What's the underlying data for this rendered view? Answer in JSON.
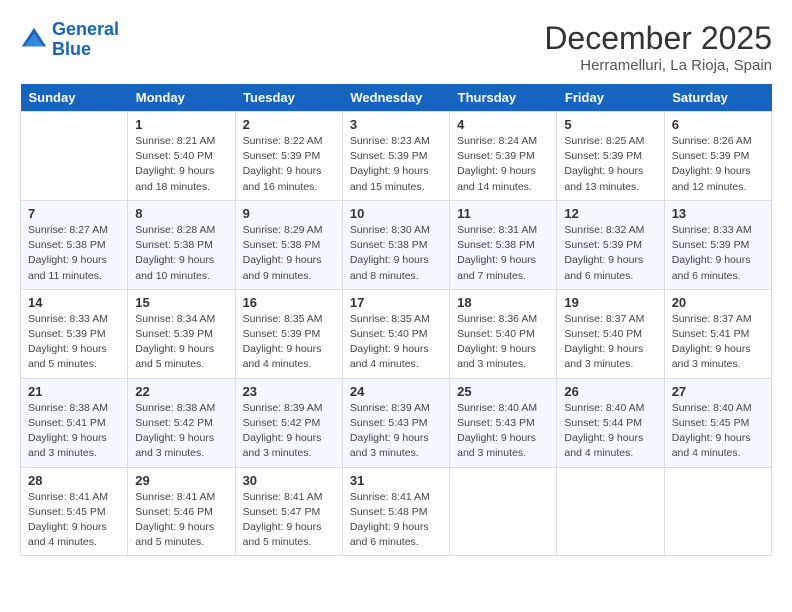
{
  "header": {
    "logo_line1": "General",
    "logo_line2": "Blue",
    "month": "December 2025",
    "location": "Herramelluri, La Rioja, Spain"
  },
  "days_of_week": [
    "Sunday",
    "Monday",
    "Tuesday",
    "Wednesday",
    "Thursday",
    "Friday",
    "Saturday"
  ],
  "weeks": [
    [
      {
        "day": "",
        "info": ""
      },
      {
        "day": "1",
        "info": "Sunrise: 8:21 AM\nSunset: 5:40 PM\nDaylight: 9 hours\nand 18 minutes."
      },
      {
        "day": "2",
        "info": "Sunrise: 8:22 AM\nSunset: 5:39 PM\nDaylight: 9 hours\nand 16 minutes."
      },
      {
        "day": "3",
        "info": "Sunrise: 8:23 AM\nSunset: 5:39 PM\nDaylight: 9 hours\nand 15 minutes."
      },
      {
        "day": "4",
        "info": "Sunrise: 8:24 AM\nSunset: 5:39 PM\nDaylight: 9 hours\nand 14 minutes."
      },
      {
        "day": "5",
        "info": "Sunrise: 8:25 AM\nSunset: 5:39 PM\nDaylight: 9 hours\nand 13 minutes."
      },
      {
        "day": "6",
        "info": "Sunrise: 8:26 AM\nSunset: 5:39 PM\nDaylight: 9 hours\nand 12 minutes."
      }
    ],
    [
      {
        "day": "7",
        "info": "Sunrise: 8:27 AM\nSunset: 5:38 PM\nDaylight: 9 hours\nand 11 minutes."
      },
      {
        "day": "8",
        "info": "Sunrise: 8:28 AM\nSunset: 5:38 PM\nDaylight: 9 hours\nand 10 minutes."
      },
      {
        "day": "9",
        "info": "Sunrise: 8:29 AM\nSunset: 5:38 PM\nDaylight: 9 hours\nand 9 minutes."
      },
      {
        "day": "10",
        "info": "Sunrise: 8:30 AM\nSunset: 5:38 PM\nDaylight: 9 hours\nand 8 minutes."
      },
      {
        "day": "11",
        "info": "Sunrise: 8:31 AM\nSunset: 5:38 PM\nDaylight: 9 hours\nand 7 minutes."
      },
      {
        "day": "12",
        "info": "Sunrise: 8:32 AM\nSunset: 5:39 PM\nDaylight: 9 hours\nand 6 minutes."
      },
      {
        "day": "13",
        "info": "Sunrise: 8:33 AM\nSunset: 5:39 PM\nDaylight: 9 hours\nand 6 minutes."
      }
    ],
    [
      {
        "day": "14",
        "info": "Sunrise: 8:33 AM\nSunset: 5:39 PM\nDaylight: 9 hours\nand 5 minutes."
      },
      {
        "day": "15",
        "info": "Sunrise: 8:34 AM\nSunset: 5:39 PM\nDaylight: 9 hours\nand 5 minutes."
      },
      {
        "day": "16",
        "info": "Sunrise: 8:35 AM\nSunset: 5:39 PM\nDaylight: 9 hours\nand 4 minutes."
      },
      {
        "day": "17",
        "info": "Sunrise: 8:35 AM\nSunset: 5:40 PM\nDaylight: 9 hours\nand 4 minutes."
      },
      {
        "day": "18",
        "info": "Sunrise: 8:36 AM\nSunset: 5:40 PM\nDaylight: 9 hours\nand 3 minutes."
      },
      {
        "day": "19",
        "info": "Sunrise: 8:37 AM\nSunset: 5:40 PM\nDaylight: 9 hours\nand 3 minutes."
      },
      {
        "day": "20",
        "info": "Sunrise: 8:37 AM\nSunset: 5:41 PM\nDaylight: 9 hours\nand 3 minutes."
      }
    ],
    [
      {
        "day": "21",
        "info": "Sunrise: 8:38 AM\nSunset: 5:41 PM\nDaylight: 9 hours\nand 3 minutes."
      },
      {
        "day": "22",
        "info": "Sunrise: 8:38 AM\nSunset: 5:42 PM\nDaylight: 9 hours\nand 3 minutes."
      },
      {
        "day": "23",
        "info": "Sunrise: 8:39 AM\nSunset: 5:42 PM\nDaylight: 9 hours\nand 3 minutes."
      },
      {
        "day": "24",
        "info": "Sunrise: 8:39 AM\nSunset: 5:43 PM\nDaylight: 9 hours\nand 3 minutes."
      },
      {
        "day": "25",
        "info": "Sunrise: 8:40 AM\nSunset: 5:43 PM\nDaylight: 9 hours\nand 3 minutes."
      },
      {
        "day": "26",
        "info": "Sunrise: 8:40 AM\nSunset: 5:44 PM\nDaylight: 9 hours\nand 4 minutes."
      },
      {
        "day": "27",
        "info": "Sunrise: 8:40 AM\nSunset: 5:45 PM\nDaylight: 9 hours\nand 4 minutes."
      }
    ],
    [
      {
        "day": "28",
        "info": "Sunrise: 8:41 AM\nSunset: 5:45 PM\nDaylight: 9 hours\nand 4 minutes."
      },
      {
        "day": "29",
        "info": "Sunrise: 8:41 AM\nSunset: 5:46 PM\nDaylight: 9 hours\nand 5 minutes."
      },
      {
        "day": "30",
        "info": "Sunrise: 8:41 AM\nSunset: 5:47 PM\nDaylight: 9 hours\nand 5 minutes."
      },
      {
        "day": "31",
        "info": "Sunrise: 8:41 AM\nSunset: 5:48 PM\nDaylight: 9 hours\nand 6 minutes."
      },
      {
        "day": "",
        "info": ""
      },
      {
        "day": "",
        "info": ""
      },
      {
        "day": "",
        "info": ""
      }
    ]
  ]
}
